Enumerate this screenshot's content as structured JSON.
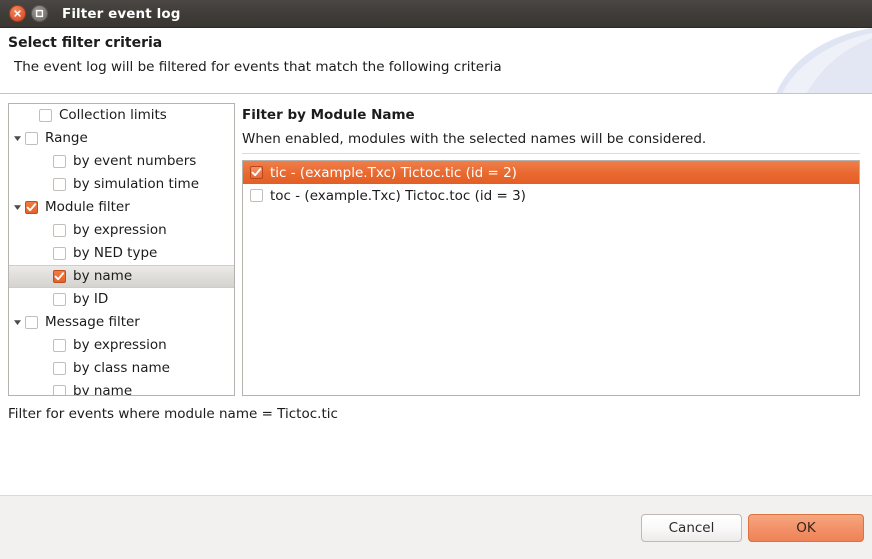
{
  "window": {
    "title": "Filter event log",
    "close_icon": "close-icon",
    "maximize_icon": "maximize-icon"
  },
  "header": {
    "title": "Select filter criteria",
    "description": "The event log will be filtered for events that match the following criteria"
  },
  "tree": {
    "items": [
      {
        "label": "Collection limits",
        "level": 1,
        "twisty": "none",
        "checked": false,
        "selected": false
      },
      {
        "label": "Range",
        "level": 0,
        "twisty": "expanded",
        "checked": false,
        "selected": false
      },
      {
        "label": "by event numbers",
        "level": 2,
        "twisty": "none",
        "checked": false,
        "selected": false
      },
      {
        "label": "by simulation time",
        "level": 2,
        "twisty": "none",
        "checked": false,
        "selected": false
      },
      {
        "label": "Module filter",
        "level": 0,
        "twisty": "expanded",
        "checked": true,
        "selected": false
      },
      {
        "label": "by expression",
        "level": 2,
        "twisty": "none",
        "checked": false,
        "selected": false
      },
      {
        "label": "by NED type",
        "level": 2,
        "twisty": "none",
        "checked": false,
        "selected": false
      },
      {
        "label": "by name",
        "level": 2,
        "twisty": "none",
        "checked": true,
        "selected": true
      },
      {
        "label": "by ID",
        "level": 2,
        "twisty": "none",
        "checked": false,
        "selected": false
      },
      {
        "label": "Message filter",
        "level": 0,
        "twisty": "expanded",
        "checked": false,
        "selected": false
      },
      {
        "label": "by expression",
        "level": 2,
        "twisty": "none",
        "checked": false,
        "selected": false
      },
      {
        "label": "by class name",
        "level": 2,
        "twisty": "none",
        "checked": false,
        "selected": false
      },
      {
        "label": "by name",
        "level": 2,
        "twisty": "none",
        "checked": false,
        "selected": false
      }
    ]
  },
  "detail": {
    "group_title": "Filter by Module Name",
    "group_description": "When enabled, modules with the selected names will be considered.",
    "modules": [
      {
        "label": "tic - (example.Txc) Tictoc.tic (id = 2)",
        "checked": true,
        "selected": true
      },
      {
        "label": "toc - (example.Txc) Tictoc.toc (id = 3)",
        "checked": false,
        "selected": false
      }
    ]
  },
  "status": {
    "text": "Filter for events where module name = Tictoc.tic"
  },
  "buttons": {
    "cancel_label": "Cancel",
    "ok_label": "OK"
  },
  "colors": {
    "accent_orange": "#e4622a",
    "selection_orange": "#e8692f",
    "ok_button": "#f2926a",
    "titlebar": "#3f3c38"
  }
}
